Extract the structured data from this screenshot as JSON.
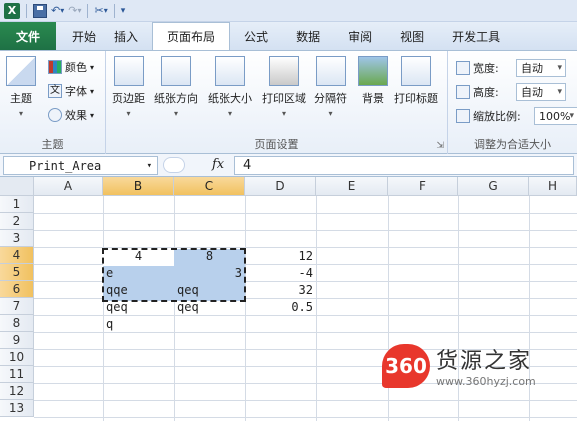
{
  "quick_access": {
    "logo": "X"
  },
  "tabs": [
    {
      "label": "文件"
    },
    {
      "label": "开始"
    },
    {
      "label": "插入"
    },
    {
      "label": "页面布局"
    },
    {
      "label": "公式"
    },
    {
      "label": "数据"
    },
    {
      "label": "审阅"
    },
    {
      "label": "视图"
    },
    {
      "label": "开发工具"
    }
  ],
  "ribbon": {
    "themes_group": {
      "label": "主题",
      "themes_button": "主题",
      "colors": "颜色",
      "fonts": "字体",
      "effects": "效果"
    },
    "page_setup_group": {
      "label": "页面设置",
      "buttons": [
        "页边距",
        "纸张方向",
        "纸张大小",
        "打印区域",
        "分隔符",
        "背景",
        "打印标题"
      ]
    },
    "scale_group": {
      "label": "调整为合适大小",
      "width_label": "宽度:",
      "width_value": "自动",
      "height_label": "高度:",
      "height_value": "自动",
      "scale_label": "缩放比例:",
      "scale_value": "100%"
    }
  },
  "formula_bar": {
    "name_box": "Print_Area",
    "fx": "fx",
    "value": "4"
  },
  "sheet": {
    "columns": [
      "A",
      "B",
      "C",
      "D",
      "E",
      "F",
      "G",
      "H"
    ],
    "rows": [
      "1",
      "2",
      "3",
      "4",
      "5",
      "6",
      "7",
      "8",
      "9",
      "10",
      "11",
      "12",
      "13"
    ],
    "cells": {
      "B4": "4",
      "C4": "8",
      "D4": "12",
      "B5": "e",
      "C5": "3",
      "D5": "-4",
      "B6": "qqe",
      "C6": "qeq",
      "D6": "32",
      "B7": "qeq",
      "C7": "qeq",
      "D7": "0.5",
      "B8": "q"
    }
  },
  "watermark": {
    "badge": "360",
    "name": "货源之家",
    "url": "www.360hyzj.com"
  }
}
